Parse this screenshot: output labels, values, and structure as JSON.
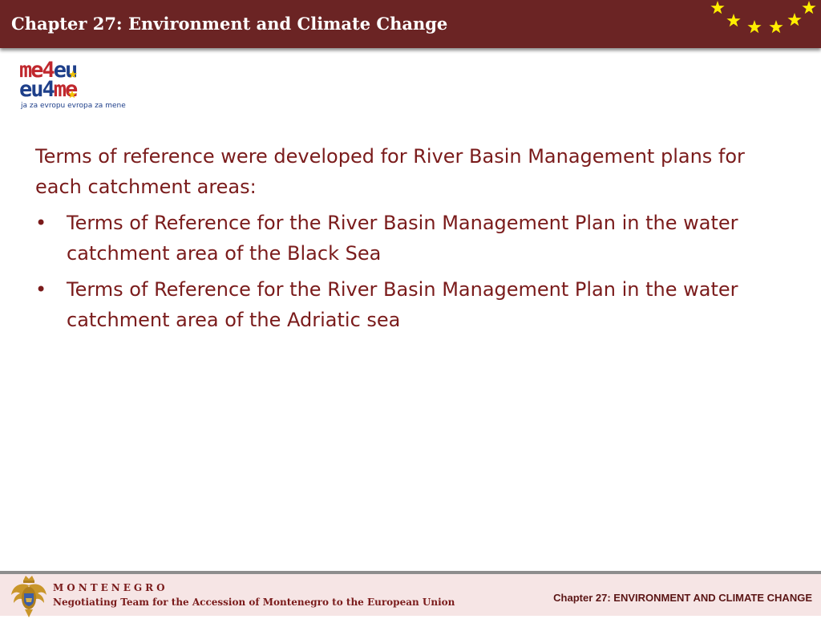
{
  "header": {
    "title": "Chapter 27: Environment and Climate Change",
    "background_color": "#6b2424",
    "star_color": "#ffee00",
    "star_icon": "eu-star-icon"
  },
  "logo": {
    "line1_red": "me4",
    "line1_blue": "eu",
    "line2_blue": "eu4",
    "line2_red": "me",
    "tagline": "ja za evropu evropa za mene"
  },
  "content": {
    "intro": "Terms of reference were developed for River Basin Management plans for each catchment areas:",
    "bullet_symbol": "•",
    "bullets": [
      "Terms of Reference for the River Basin Management Plan  in the water catchment  area of the Black Sea",
      "Terms of Reference for the River Basin Management Plan  in the water catchment area of the Adriatic sea"
    ],
    "text_color": "#7a1b1b"
  },
  "footer": {
    "country": "MONTENEGRO",
    "subtitle": "Negotiating Team for the Accession of  Montenegro to the European Union",
    "chapter_label": "Chapter 27:  ENVIRONMENT AND CLIMATE CHANGE",
    "coat_icon": "montenegro-coat-of-arms-icon",
    "background_color": "#f6e5e5"
  }
}
